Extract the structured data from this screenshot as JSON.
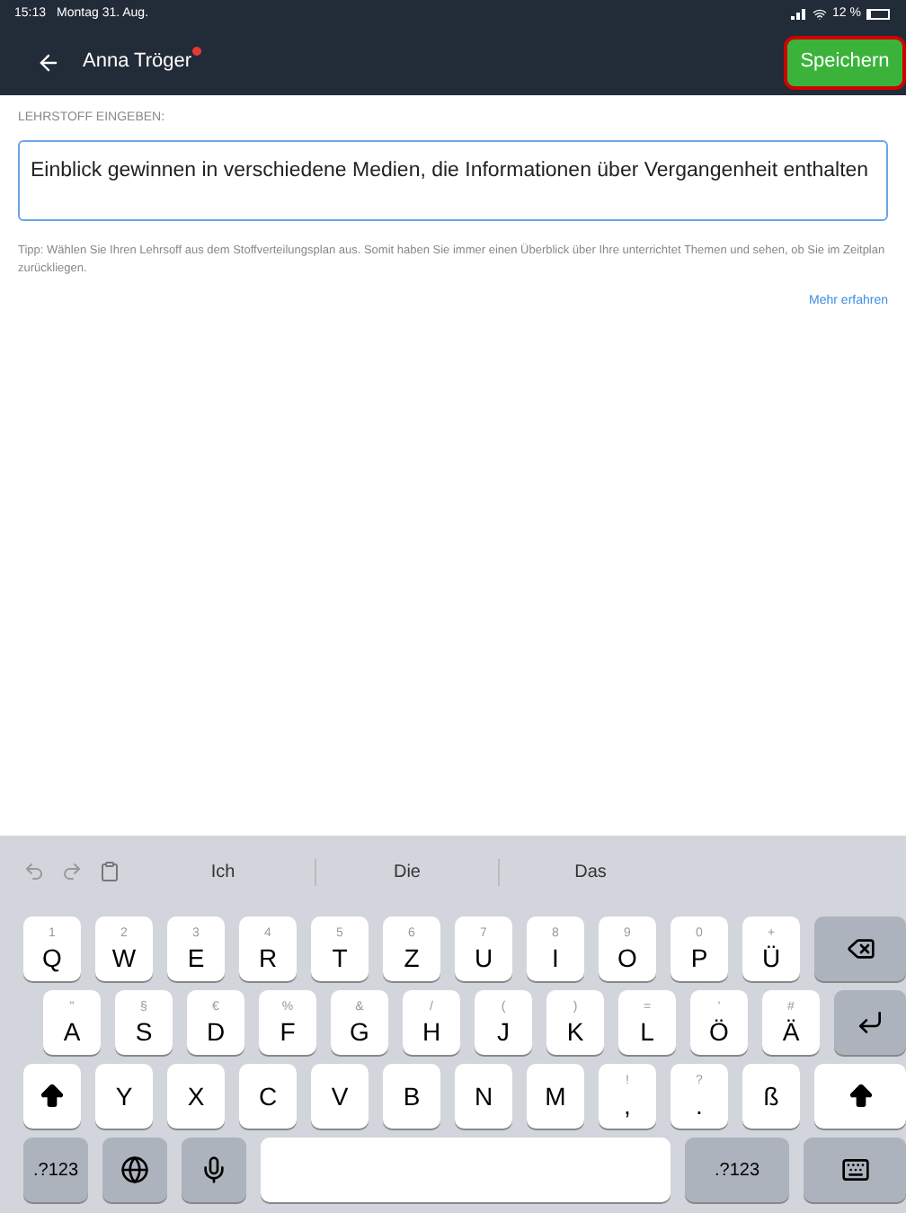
{
  "status_bar": {
    "time": "15:13",
    "date": "Montag 31. Aug.",
    "battery": "12 %"
  },
  "nav": {
    "title": "Anna Tröger",
    "unread": true,
    "save_button": {
      "label": "Speichern",
      "highlighted": true
    }
  },
  "form": {
    "label": "LEHRSTOFF EINGEBEN:",
    "value": "Einblick gewinnen in verschiedene Medien, die Informationen über Vergangenheit enthalten",
    "focused": true,
    "tip": "Tipp: Wählen Sie Ihren Lehrsoff aus dem Stoffverteilungsplan aus. Somit haben Sie immer einen Überblick über Ihre unterrichtet Themen und sehen, ob Sie im Zeitplan zurückliegen.",
    "link": "Mehr erfahren"
  },
  "keyboard": {
    "suggestions": [
      "Ich",
      "Die",
      "Das"
    ],
    "rows": [
      [
        {
          "kind": "letter",
          "label": "Q",
          "hint": "1"
        },
        {
          "kind": "letter",
          "label": "W",
          "hint": "2"
        },
        {
          "kind": "letter",
          "label": "E",
          "hint": "3"
        },
        {
          "kind": "letter",
          "label": "R",
          "hint": "4"
        },
        {
          "kind": "letter",
          "label": "T",
          "hint": "5"
        },
        {
          "kind": "letter",
          "label": "Z",
          "hint": "6"
        },
        {
          "kind": "letter",
          "label": "U",
          "hint": "7"
        },
        {
          "kind": "letter",
          "label": "I",
          "hint": "8"
        },
        {
          "kind": "letter",
          "label": "O",
          "hint": "9"
        },
        {
          "kind": "letter",
          "label": "P",
          "hint": "0"
        },
        {
          "kind": "letter",
          "label": "Ü",
          "hint": "+"
        },
        {
          "kind": "backspace"
        }
      ],
      [
        {
          "kind": "letter",
          "label": "A",
          "hint": "\""
        },
        {
          "kind": "letter",
          "label": "S",
          "hint": "§"
        },
        {
          "kind": "letter",
          "label": "D",
          "hint": "€"
        },
        {
          "kind": "letter",
          "label": "F",
          "hint": "%"
        },
        {
          "kind": "letter",
          "label": "G",
          "hint": "&"
        },
        {
          "kind": "letter",
          "label": "H",
          "hint": "/"
        },
        {
          "kind": "letter",
          "label": "J",
          "hint": "("
        },
        {
          "kind": "letter",
          "label": "K",
          "hint": ")"
        },
        {
          "kind": "letter",
          "label": "L",
          "hint": "="
        },
        {
          "kind": "letter",
          "label": "Ö",
          "hint": "'"
        },
        {
          "kind": "letter",
          "label": "Ä",
          "hint": "#"
        },
        {
          "kind": "enter"
        }
      ],
      [
        {
          "kind": "shift"
        },
        {
          "kind": "letter",
          "label": "Y"
        },
        {
          "kind": "letter",
          "label": "X"
        },
        {
          "kind": "letter",
          "label": "C"
        },
        {
          "kind": "letter",
          "label": "V"
        },
        {
          "kind": "letter",
          "label": "B"
        },
        {
          "kind": "letter",
          "label": "N"
        },
        {
          "kind": "letter",
          "label": "M"
        },
        {
          "kind": "letter",
          "label": ",",
          "hint": "!"
        },
        {
          "kind": "letter",
          "label": ".",
          "hint": "?"
        },
        {
          "kind": "letter",
          "label": "ß"
        },
        {
          "kind": "shift"
        }
      ],
      [
        {
          "kind": "mode",
          "label": ".?123"
        },
        {
          "kind": "globe"
        },
        {
          "kind": "mic"
        },
        {
          "kind": "space"
        },
        {
          "kind": "mode",
          "label": ".?123"
        },
        {
          "kind": "hide"
        }
      ]
    ]
  }
}
